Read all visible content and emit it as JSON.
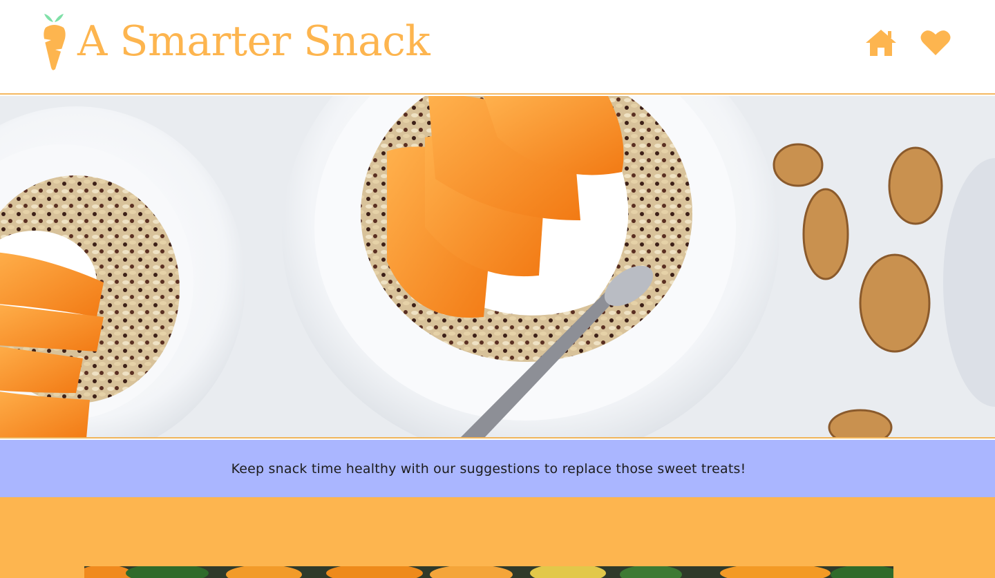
{
  "header": {
    "title": "A Smarter Snack",
    "logo_icon": "carrot-icon",
    "nav": [
      {
        "name": "home",
        "icon": "home-icon"
      },
      {
        "name": "favorites",
        "icon": "heart-icon"
      }
    ]
  },
  "hero": {
    "image": "granola bowls with persimmon slices, yogurt and walnuts"
  },
  "tagline": {
    "text": "Keep snack time healthy with our suggestions to replace those sweet treats!"
  },
  "colors": {
    "brand_orange": "#fdb54f",
    "leaf_green": "#7fe0a8",
    "tagline_bg": "#aab6ff",
    "header_border": "#f4b860"
  }
}
